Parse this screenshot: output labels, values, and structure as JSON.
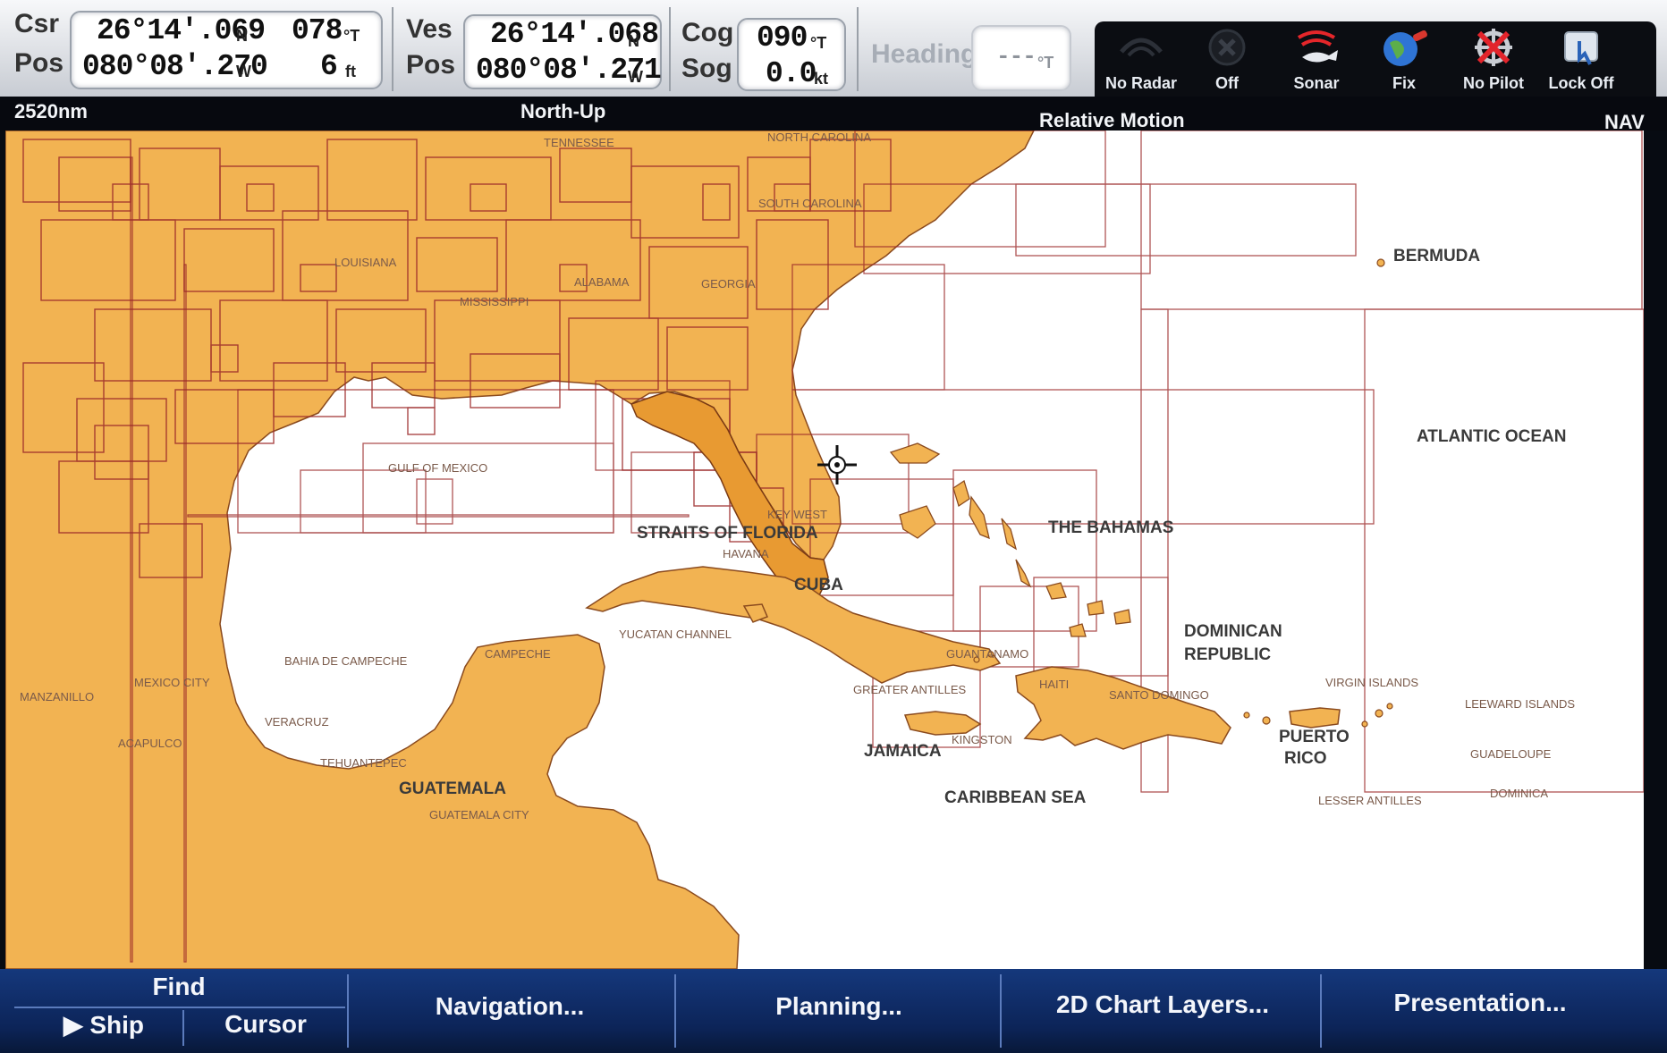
{
  "header": {
    "cursor": {
      "label_top": "Csr",
      "label_bottom": "Pos",
      "lat": "26°14'.069",
      "lat_hemi": "N",
      "lon": "080°08'.270",
      "lon_hemi": "W",
      "bearing": "078",
      "bearing_unit": "°T",
      "range": "6",
      "range_unit": "ft"
    },
    "vessel": {
      "label_top": "Ves",
      "label_bottom": "Pos",
      "lat": "26°14'.068",
      "lat_hemi": "N",
      "lon": "080°08'.271",
      "lon_hemi": "W"
    },
    "cog_sog": {
      "cog_label": "Cog",
      "sog_label": "Sog",
      "cog": "090",
      "cog_unit": "°T",
      "sog": "0.0",
      "sog_unit": "kt"
    },
    "heading": {
      "label": "Heading",
      "value": "---",
      "unit": "°T"
    }
  },
  "tools": [
    {
      "label": "No Radar",
      "icon": "radar-icon"
    },
    {
      "label": "Off",
      "icon": "power-off-icon"
    },
    {
      "label": "Sonar",
      "icon": "sonar-fish-icon"
    },
    {
      "label": "Fix",
      "icon": "gps-fix-globe-icon"
    },
    {
      "label": "No Pilot",
      "icon": "autopilot-off-icon"
    },
    {
      "label": "Lock Off",
      "icon": "touch-lock-icon"
    }
  ],
  "status": {
    "range": "2520nm",
    "orientation": "North-Up",
    "motion": "Relative Motion",
    "mode": "NAV"
  },
  "map": {
    "labels": {
      "tennessee": "TENNESSEE",
      "north_carolina": "NORTH CAROLINA",
      "south_carolina": "SOUTH CAROLINA",
      "alabama": "ALABAMA",
      "georgia": "GEORGIA",
      "mississippi": "MISSISSIPPI",
      "louisiana": "LOUISIANA",
      "bermuda": "BERMUDA",
      "atlantic_ocean": "ATLANTIC OCEAN",
      "gulf_of_mexico": "GULF OF MEXICO",
      "straits_of_florida": "STRAITS OF FLORIDA",
      "key_west": "KEY WEST",
      "havana": "HAVANA",
      "the_bahamas": "THE BAHAMAS",
      "cuba": "CUBA",
      "yucatan_channel": "YUCATAN CHANNEL",
      "campeche": "CAMPECHE",
      "bahia_de_campeche": "BAHIA DE CAMPECHE",
      "mexico_city": "MEXICO CITY",
      "manzanillo": "MANZANILLO",
      "veracruz": "VERACRUZ",
      "acapulco": "ACAPULCO",
      "tehuantepec": "TEHUANTEPEC",
      "guatemala": "GUATEMALA",
      "guatemala_city": "GUATEMALA CITY",
      "guantanamo": "GUANTANAMO",
      "greater_antilles": "GREATER ANTILLES",
      "haiti": "HAITI",
      "santo_domingo": "SANTO DOMINGO",
      "dominican_1": "DOMINICAN",
      "dominican_2": "REPUBLIC",
      "jamaica": "JAMAICA",
      "kingston": "KINGSTON",
      "caribbean_sea": "CARIBBEAN SEA",
      "puerto_1": "PUERTO",
      "puerto_2": "RICO",
      "virgin_islands": "VIRGIN ISLANDS",
      "leeward_islands": "LEEWARD ISLANDS",
      "guadeloupe": "GUADELOUPE",
      "dominica": "DOMINICA",
      "lesser_antilles": "LESSER ANTILLES"
    },
    "colors": {
      "land": "#f2b352",
      "land_dark": "#e79a34",
      "sea": "#ffffff",
      "chart_line": "#9c2a2a",
      "label": "#6b4a3a"
    }
  },
  "menu": {
    "find": "Find",
    "ship": "▶ Ship",
    "cursor": "Cursor",
    "navigation": "Navigation...",
    "planning": "Planning...",
    "chart_layers": "2D Chart Layers...",
    "presentation": "Presentation..."
  }
}
